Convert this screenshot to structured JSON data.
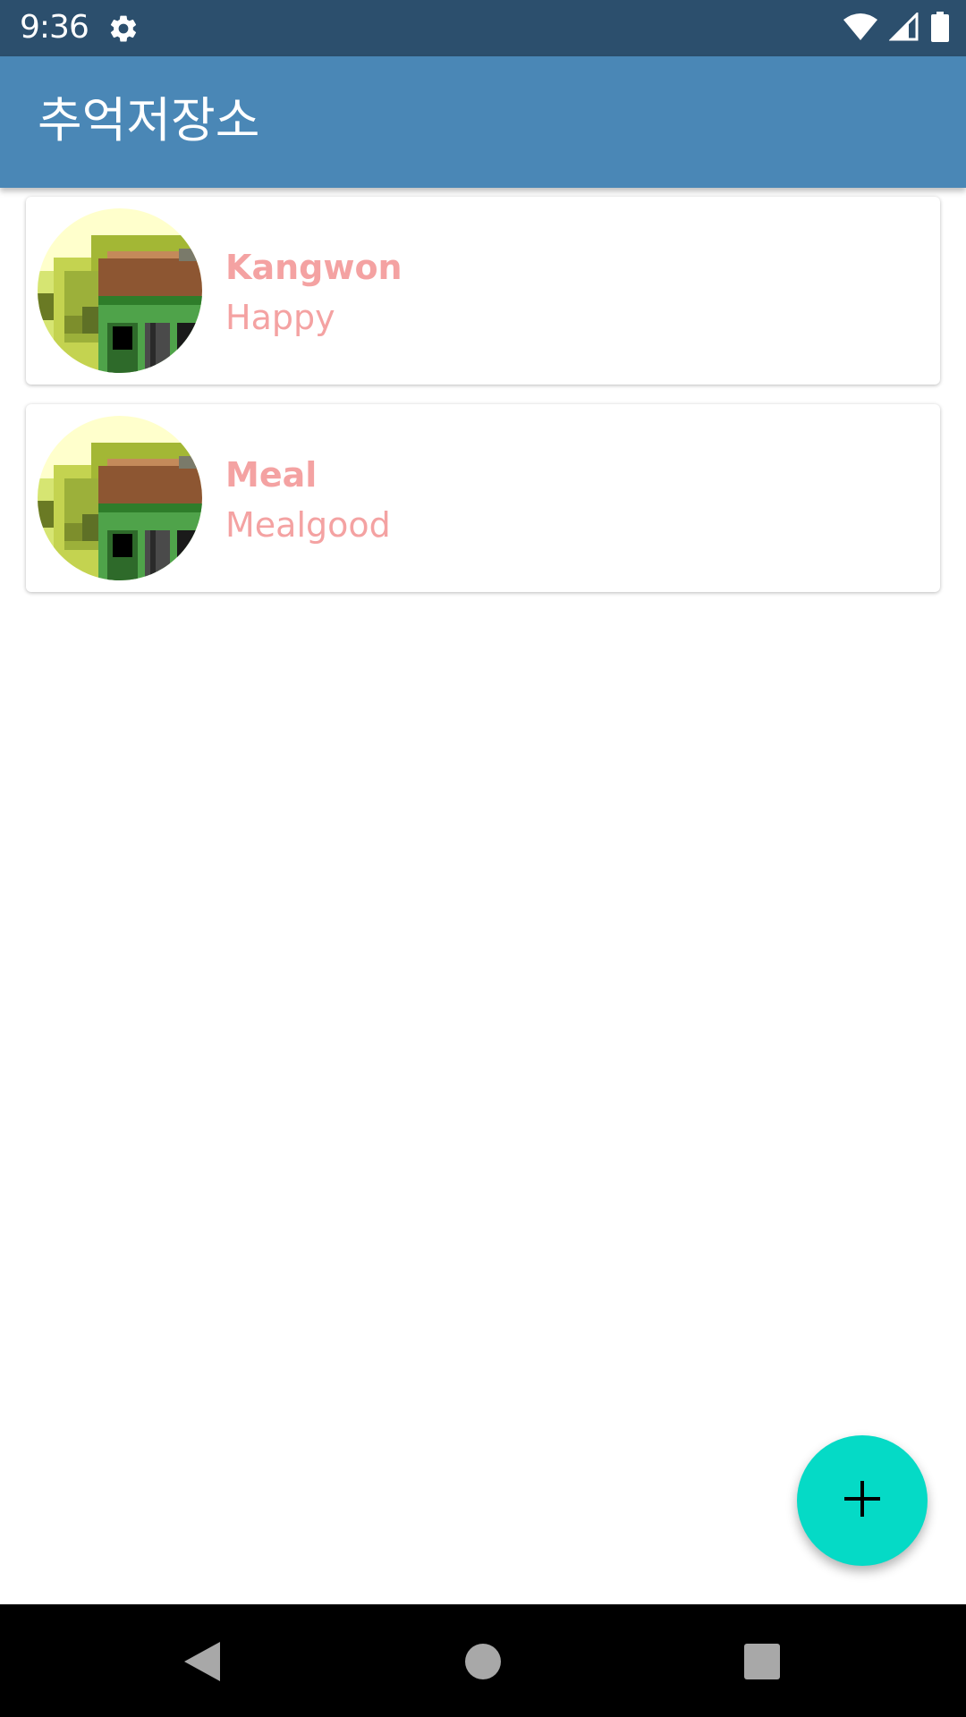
{
  "status_bar": {
    "time": "9:36",
    "icons": [
      "settings-icon",
      "wifi-icon",
      "signal-icon",
      "battery-icon"
    ]
  },
  "app_bar": {
    "title": "추억저장소"
  },
  "memories": [
    {
      "title": "Kangwon",
      "subtitle": "Happy"
    },
    {
      "title": "Meal",
      "subtitle": "Mealgood"
    }
  ],
  "fab": {
    "icon": "plus-icon"
  },
  "nav_bar": {
    "icons": [
      "back-icon",
      "home-icon",
      "recents-icon"
    ]
  },
  "colors": {
    "status_bar": "#2c4f6d",
    "app_bar": "#4a87b6",
    "item_text": "#f4a2a2",
    "fab": "#05dac6"
  }
}
